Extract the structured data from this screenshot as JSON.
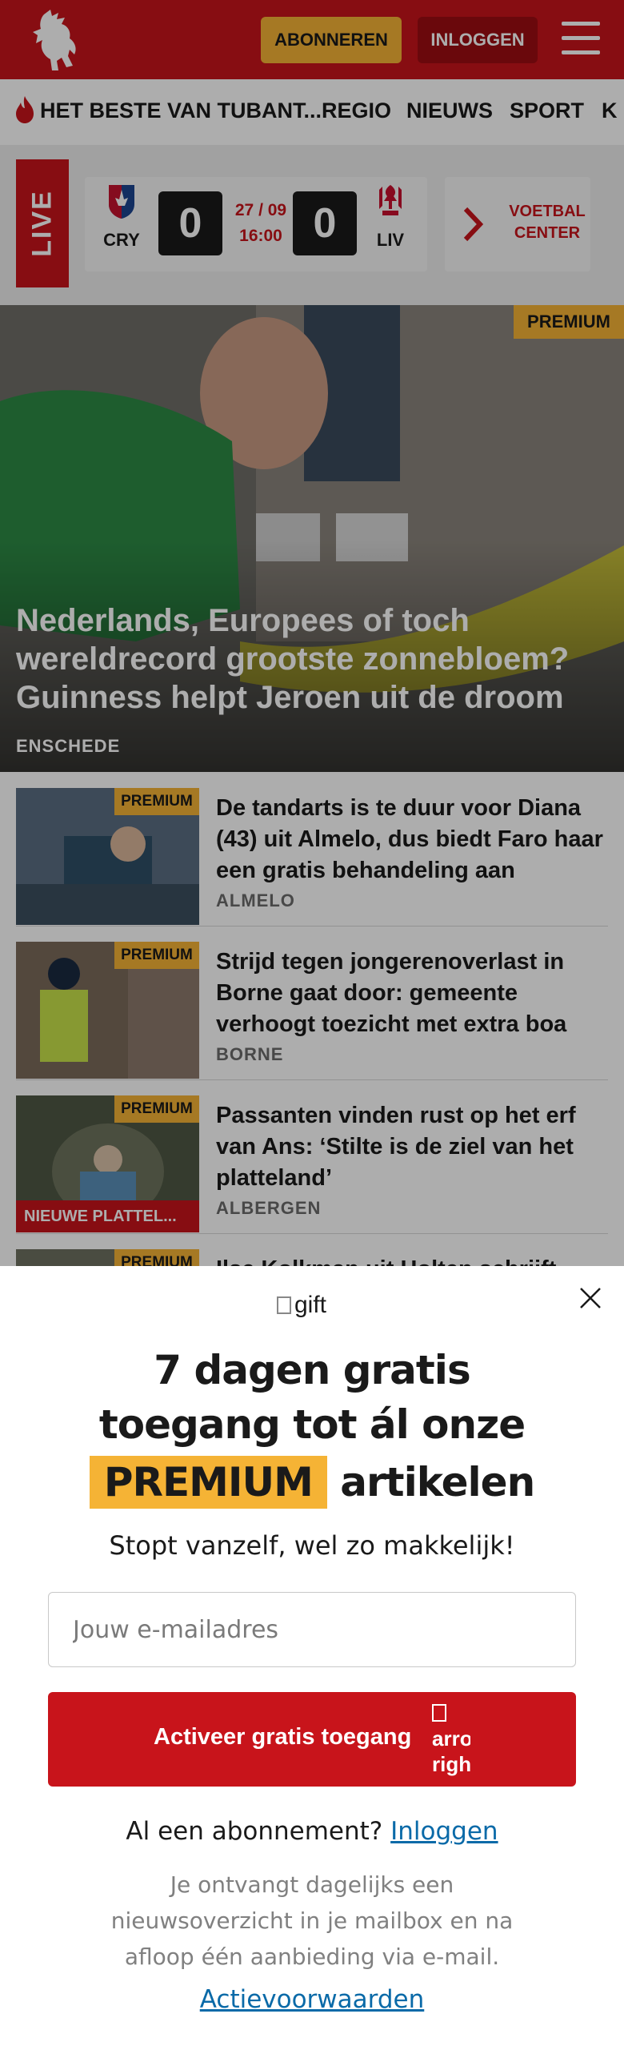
{
  "header": {
    "subscribe_label": "ABONNEREN",
    "login_label": "INLOGGEN",
    "brand_color": "#c8141b",
    "accent_color": "#f5b335"
  },
  "nav": {
    "items": [
      "HET BESTE VAN TUBANT...",
      "REGIO",
      "NIEUWS",
      "SPORT",
      "K"
    ]
  },
  "live": {
    "label": "LIVE",
    "match": {
      "home": "CRY",
      "away": "LIV",
      "home_score": "0",
      "away_score": "0",
      "date": "27 / 09",
      "time": "16:00"
    },
    "voetbal_center_line1": "VOETBAL",
    "voetbal_center_line2": "CENTER"
  },
  "hero": {
    "badge": "PREMIUM",
    "title": "Nederlands, Europees of toch wereldrecord grootste zonnebloem? Guinness helpt Jeroen uit de droom",
    "location": "ENSCHEDE"
  },
  "articles": [
    {
      "badge": "PREMIUM",
      "title": "De tandarts is te duur voor Diana (43) uit Almelo, dus biedt Faro haar een gratis behandeling aan",
      "location": "ALMELO",
      "ribbon": ""
    },
    {
      "badge": "PREMIUM",
      "title": "Strijd tegen jongerenoverlast in Borne gaat door: gemeente verhoogt toezicht met extra boa",
      "location": "BORNE",
      "ribbon": ""
    },
    {
      "badge": "PREMIUM",
      "title": "Passanten vinden rust op het erf van Ans: ‘Stilte is de ziel van het platteland’",
      "location": "ALBERGEN",
      "ribbon": "NIEUWE PLATTEL..."
    },
    {
      "badge": "PREMIUM",
      "title": "Ilse Kolkman uit Holten schrijft",
      "location": "",
      "ribbon": ""
    }
  ],
  "modal": {
    "gift_alt": "gift",
    "headline_line1": "7 dagen gratis",
    "headline_line2": "toegang tot ál onze",
    "headline_premium": "PREMIUM",
    "headline_end": "artikelen",
    "subline": "Stopt vanzelf, wel zo makkelijk!",
    "email_placeholder": "Jouw e-mailadres",
    "cta_label": "Activeer gratis toegang",
    "cta_arrow_alt": "arrow-right",
    "have_subscription": "Al een abonnement?",
    "login_link": "Inloggen",
    "fine_print": "Je ontvangt dagelijks een nieuwsoverzicht in je mailbox en na afloop één aanbieding via e-mail.",
    "terms_link": "Actievoorwaarden"
  }
}
